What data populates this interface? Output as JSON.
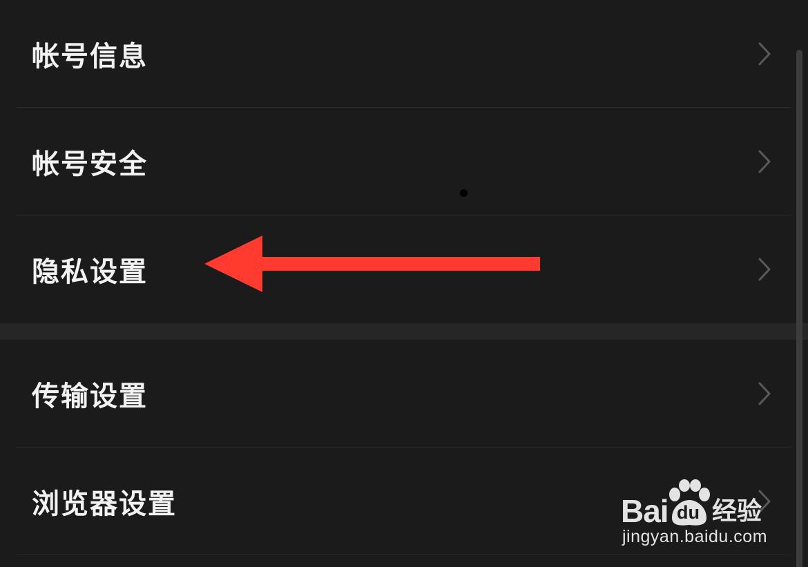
{
  "settings_list": {
    "group1": [
      {
        "label": "帐号信息"
      },
      {
        "label": "帐号安全"
      },
      {
        "label": "隐私设置"
      }
    ],
    "group2": [
      {
        "label": "传输设置"
      },
      {
        "label": "浏览器设置"
      }
    ]
  },
  "annotation": {
    "arrow_color": "#ff3b30",
    "points_to": "隐私设置"
  },
  "watermark": {
    "brand_left": "Bai",
    "brand_paw_text": "du",
    "brand_right": "经验",
    "url": "jingyan.baidu.com"
  },
  "icons": {
    "row_chevron": "chevron-right-icon"
  },
  "colors": {
    "background": "#1b1b1b",
    "section_gap": "#262626",
    "divider": "#2d2d2d",
    "text": "#f2f2f2",
    "chevron": "#5a5a5a"
  }
}
